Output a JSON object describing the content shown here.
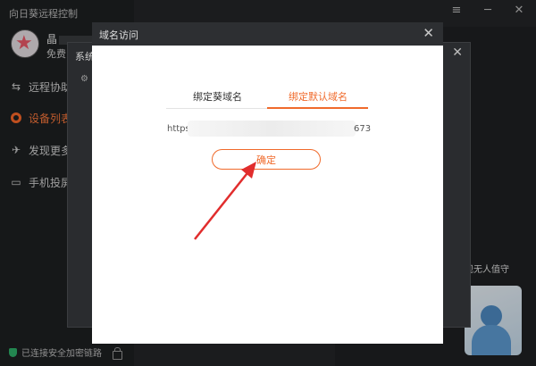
{
  "app": {
    "title": "向日葵远程控制"
  },
  "user": {
    "name": "晶",
    "plan": "免费",
    "avatar_icon": "star-avatar-icon"
  },
  "sidebar": {
    "items": [
      {
        "label": "远程协助",
        "icon": "remote-assist-icon"
      },
      {
        "label": "设备列表",
        "icon": "device-list-icon",
        "active": true
      },
      {
        "label": "发现更多",
        "icon": "discover-icon"
      },
      {
        "label": "手机投屏",
        "icon": "screen-cast-icon"
      }
    ],
    "status": "已连接安全加密链路"
  },
  "window_controls": {
    "menu": "≡",
    "minimize": "─",
    "close": "✕"
  },
  "system_dialog": {
    "title": "系统",
    "close": "✕"
  },
  "domain_dialog": {
    "title": "域名访问",
    "close": "✕",
    "tabs": [
      {
        "label": "绑定葵域名"
      },
      {
        "label": "绑定默认域名",
        "active": true
      }
    ],
    "url_prefix": "https",
    "url_suffix": "673",
    "confirm_label": "确定"
  },
  "promo": {
    "text": "现无人值守"
  },
  "colors": {
    "accent": "#f06a2b",
    "sidebar_bg": "#1e2022",
    "dialog_header": "#2d2f32",
    "secure": "#2fb36b"
  }
}
